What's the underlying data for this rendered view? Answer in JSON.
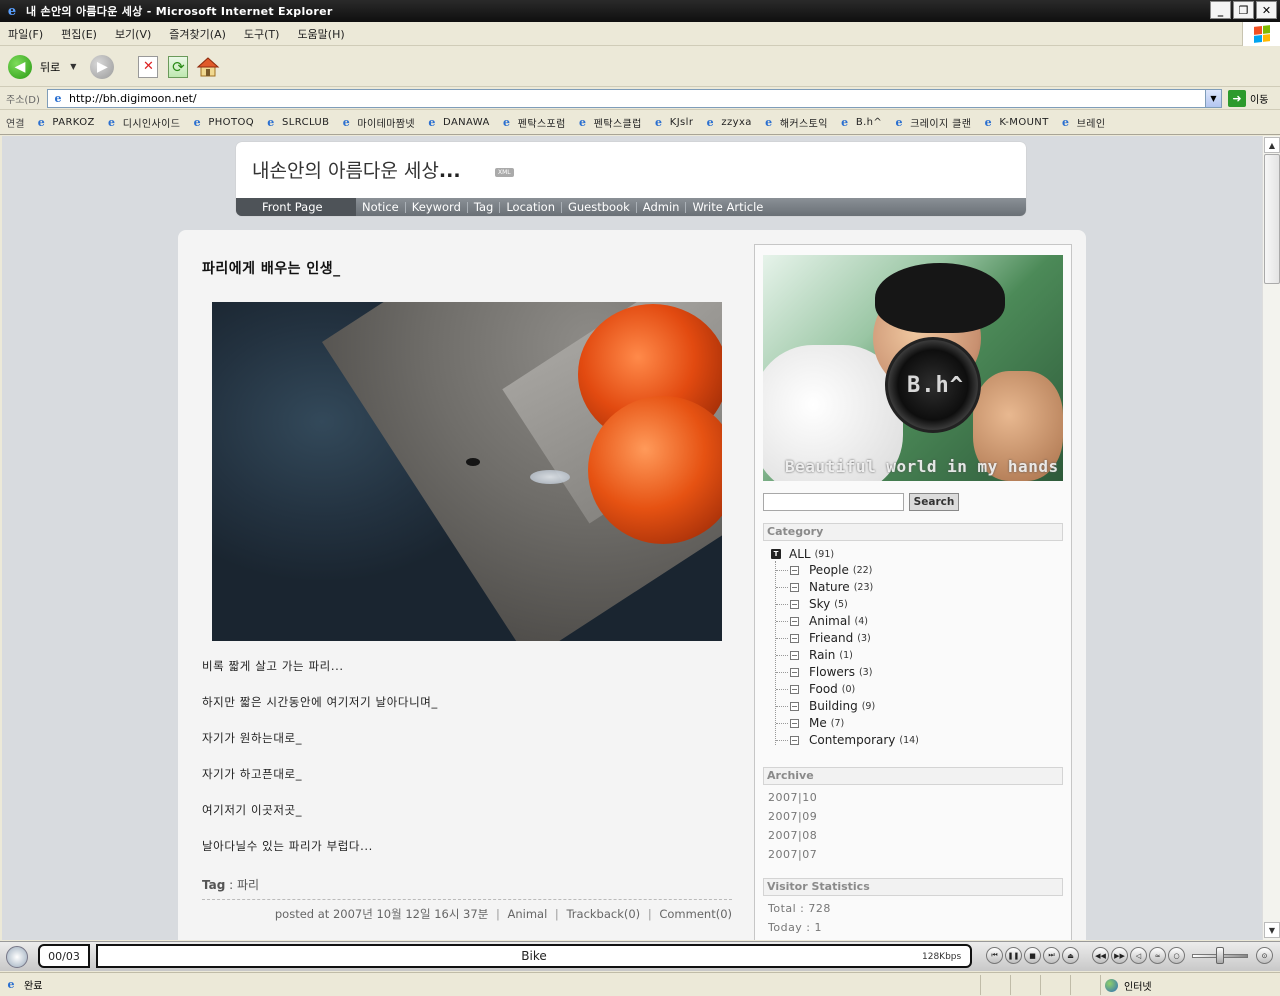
{
  "window": {
    "title": "내 손안의 아름다운 세상 - Microsoft Internet Explorer",
    "controls": [
      "_",
      "❐",
      "✕"
    ]
  },
  "menu": [
    "파일(F)",
    "편집(E)",
    "보기(V)",
    "즐겨찾기(A)",
    "도구(T)",
    "도움말(H)"
  ],
  "toolbar": {
    "back_label": "뒤로"
  },
  "address": {
    "label": "주소(D)",
    "url": "http://bh.digimoon.net/",
    "go_label": "이동"
  },
  "links": {
    "label": "연결",
    "items": [
      "PARKOZ",
      "디시인사이드",
      "PHOTOQ",
      "SLRCLUB",
      "마이테마짬넷",
      "DANAWA",
      "펜탁스포럼",
      "펜탁스클럽",
      "KJslr",
      "zzyxa",
      "해커스토익",
      "B.h^",
      "크레이지 클랜",
      "K-MOUNT",
      "브레인"
    ]
  },
  "blog": {
    "title": "내손안의 아름다운 세상",
    "title_dots": "...",
    "xml_badge": "XML",
    "nav": {
      "front": "Front Page",
      "items": [
        "Notice",
        "Keyword",
        "Tag",
        "Location",
        "Guestbook",
        "Admin",
        "Write Article"
      ]
    }
  },
  "post": {
    "title": "파리에게 배우는 인생_",
    "lines": [
      "비록 짧게 살고 가는 파리...",
      "하지만 짧은 시간동안에 여기저기 날아다니며_",
      "자기가 원하는대로_",
      "자기가 하고픈대로_",
      "여기저기 이곳저곳_",
      "날아다닐수 있는 파리가 부럽다..."
    ],
    "tag_label": "Tag",
    "tag_sep": " : ",
    "tag_value": "파리",
    "footer": {
      "posted": "posted at 2007년 10월 12일 16시 37분",
      "category": "Animal",
      "trackback": "Trackback(0)",
      "comment": "Comment(0)",
      "sep": "|"
    }
  },
  "sidebar": {
    "profile": {
      "cam_text": "B.h^",
      "tagline": "Beautiful world in my hands"
    },
    "search": {
      "placeholder": "",
      "button": "Search"
    },
    "category": {
      "heading": "Category",
      "root": {
        "icon": "T",
        "label": "ALL",
        "count": "(91)"
      },
      "items": [
        {
          "label": "People",
          "count": "(22)"
        },
        {
          "label": "Nature",
          "count": "(23)"
        },
        {
          "label": "Sky",
          "count": "(5)"
        },
        {
          "label": "Animal",
          "count": "(4)"
        },
        {
          "label": "Frieand",
          "count": "(3)"
        },
        {
          "label": "Rain",
          "count": "(1)"
        },
        {
          "label": "Flowers",
          "count": "(3)"
        },
        {
          "label": "Food",
          "count": "(0)"
        },
        {
          "label": "Building",
          "count": "(9)"
        },
        {
          "label": "Me",
          "count": "(7)"
        },
        {
          "label": "Contemporary",
          "count": "(14)"
        }
      ]
    },
    "archive": {
      "heading": "Archive",
      "items": [
        "2007|10",
        "2007|09",
        "2007|08",
        "2007|07"
      ]
    },
    "visitor": {
      "heading": "Visitor Statistics",
      "total": "Total : 728",
      "today": "Today : 1"
    }
  },
  "media": {
    "counter": "00/03",
    "track": "Bike",
    "bitrate": "128Kbps"
  },
  "status": {
    "text": "완료",
    "zone": "인터넷"
  }
}
